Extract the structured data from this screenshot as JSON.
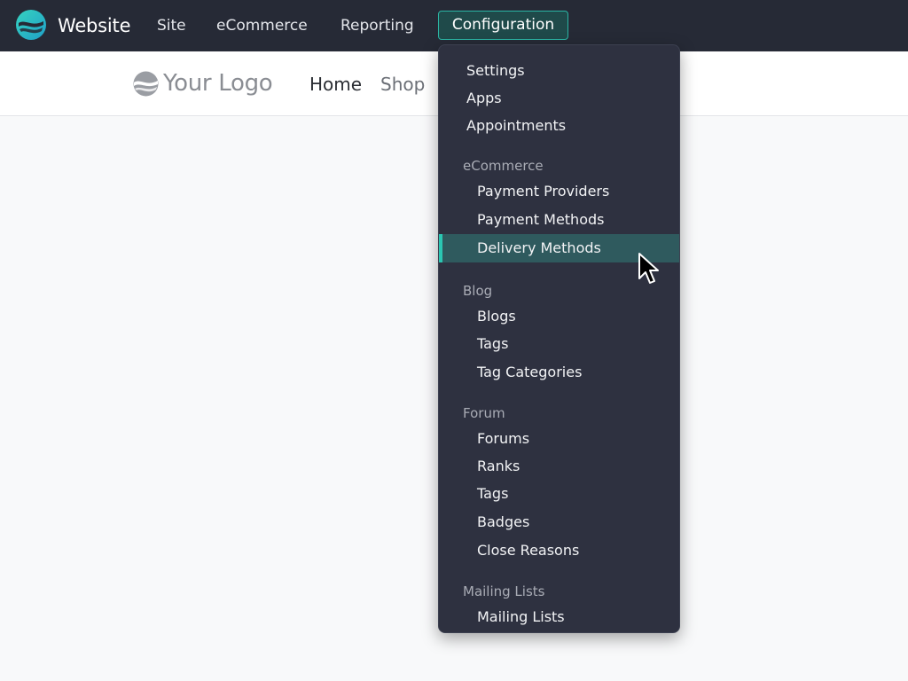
{
  "topbar": {
    "app_name": "Website",
    "nav": [
      "Site",
      "eCommerce",
      "Reporting"
    ],
    "active_menu": "Configuration",
    "logo_icon": "website-app-icon",
    "colors": {
      "bg": "#262a36",
      "accent": "#2bb5a4"
    }
  },
  "site": {
    "logo_text": "Your Logo",
    "logo_icon": "your-logo-icon",
    "nav": [
      {
        "label": "Home",
        "active": true
      },
      {
        "label": "Shop",
        "active": false
      }
    ]
  },
  "dropdown": {
    "top_items": [
      "Settings",
      "Apps",
      "Appointments"
    ],
    "sections": [
      {
        "header": "eCommerce",
        "items": [
          "Payment Providers",
          "Payment Methods",
          "Delivery Methods"
        ]
      },
      {
        "header": "Blog",
        "items": [
          "Blogs",
          "Tags",
          "Tag Categories"
        ]
      },
      {
        "header": "Forum",
        "items": [
          "Forums",
          "Ranks",
          "Tags",
          "Badges",
          "Close Reasons"
        ]
      },
      {
        "header": "Mailing Lists",
        "items": [
          "Mailing Lists"
        ]
      }
    ],
    "active_item": "Delivery Methods",
    "colors": {
      "bg": "#2e3140",
      "active_bg": "#2f5a5e",
      "active_bar": "#2bc7b3"
    }
  },
  "cursor_icon": "mouse-pointer-icon"
}
